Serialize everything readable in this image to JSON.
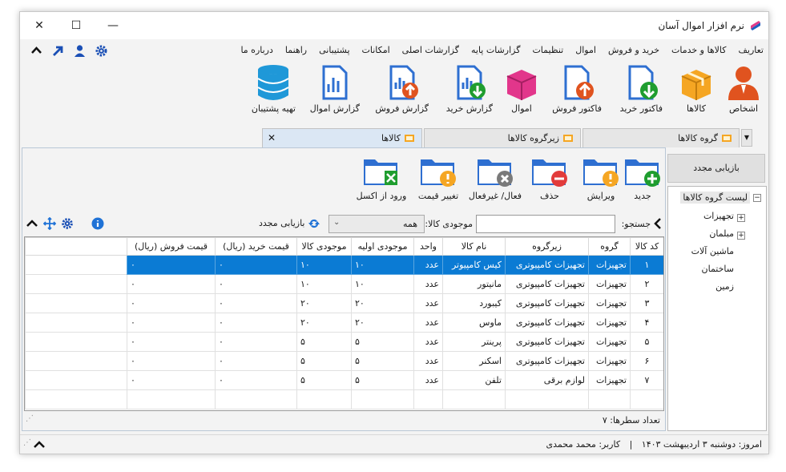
{
  "app": {
    "title": "نرم افزار اموال آسان"
  },
  "menu": [
    "تعاریف",
    "کالاها و خدمات",
    "خرید و فروش",
    "اموال",
    "تنظیمات",
    "گزارشات پایه",
    "گزارشات اصلی",
    "امکانات",
    "پشتیبانی",
    "راهنما",
    "درباره ما"
  ],
  "ribbon": [
    {
      "label": "اشخاص",
      "icon": "person-icon"
    },
    {
      "label": "کالاها",
      "icon": "box-icon"
    },
    {
      "label": "فاکتور خرید",
      "icon": "purchase-invoice-icon"
    },
    {
      "label": "فاکتور فروش",
      "icon": "sales-invoice-icon"
    },
    {
      "label": "اموال",
      "icon": "assets-box-icon"
    },
    {
      "label": "گزارش خرید",
      "icon": "purchase-report-icon"
    },
    {
      "label": "گزارش فروش",
      "icon": "sales-report-icon"
    },
    {
      "label": "گزارش اموال",
      "icon": "assets-report-icon"
    },
    {
      "label": "تهیه پشتیبان",
      "icon": "database-icon"
    }
  ],
  "tabs": [
    {
      "label": "گروه کالاها",
      "active": false
    },
    {
      "label": "زیرگروه کالاها",
      "active": false
    },
    {
      "label": "کالاها",
      "active": true
    }
  ],
  "toolbar": [
    {
      "label": "جدید",
      "badge": "plus"
    },
    {
      "label": "ویرایش",
      "badge": "warning"
    },
    {
      "label": "حذف",
      "badge": "minus"
    },
    {
      "label": "فعال/ غیرفعال",
      "badge": "x"
    },
    {
      "label": "تغییر قیمت",
      "badge": "warning"
    },
    {
      "label": "ورود از اکسل",
      "badge": "excel"
    }
  ],
  "search": {
    "label": "جستجو:",
    "value": "",
    "stock_label": "موجودی کالا:",
    "stock_value": "همه",
    "refresh_label": "بازیابی مجدد"
  },
  "table": {
    "columns": [
      "کد کالا",
      "گروه",
      "زیرگروه",
      "نام کالا",
      "واحد",
      "موجودی اولیه",
      "موجودی کالا",
      "قیمت خرید (ریال)",
      "قیمت فروش (ریال)"
    ],
    "rows": [
      [
        "۱",
        "تجهیزات",
        "تجهیزات کامپیوتری",
        "کیس کامپیوتر",
        "عدد",
        "۱۰",
        "۱۰",
        "۰",
        "۰"
      ],
      [
        "۲",
        "تجهیزات",
        "تجهیزات کامپیوتری",
        "مانیتور",
        "عدد",
        "۱۰",
        "۱۰",
        "۰",
        "۰"
      ],
      [
        "۳",
        "تجهیزات",
        "تجهیزات کامپیوتری",
        "کیبورد",
        "عدد",
        "۲۰",
        "۲۰",
        "۰",
        "۰"
      ],
      [
        "۴",
        "تجهیزات",
        "تجهیزات کامپیوتری",
        "ماوس",
        "عدد",
        "۲۰",
        "۲۰",
        "۰",
        "۰"
      ],
      [
        "۵",
        "تجهیزات",
        "تجهیزات کامپیوتری",
        "پرینتر",
        "عدد",
        "۵",
        "۵",
        "۰",
        "۰"
      ],
      [
        "۶",
        "تجهیزات",
        "تجهیزات کامپیوتری",
        "اسکنر",
        "عدد",
        "۵",
        "۵",
        "۰",
        "۰"
      ],
      [
        "۷",
        "تجهیزات",
        "لوازم برقی",
        "تلفن",
        "عدد",
        "۵",
        "۵",
        "۰",
        "۰"
      ]
    ],
    "selected_row": 0,
    "row_count_label": "تعداد سطرها:",
    "row_count": "۷"
  },
  "right_panel": {
    "refresh_label": "بازیابی مجدد",
    "tree_root": "لیست گروه کالاها",
    "tree_children": [
      "تجهیزات",
      "مبلمان",
      "ماشین آلات",
      "ساختمان",
      "زمین"
    ]
  },
  "status": {
    "date_text": "امروز: دوشنبه ۳ اردیبهشت ۱۴۰۳",
    "separator": "|",
    "user_text": "کاربر: محمد محمدی"
  },
  "colors": {
    "selection": "#0b7bd4",
    "folder": "#2e6fd1",
    "accent_orange": "#f08a1c",
    "red": "#e23b3b",
    "green": "#1f9d2f"
  }
}
